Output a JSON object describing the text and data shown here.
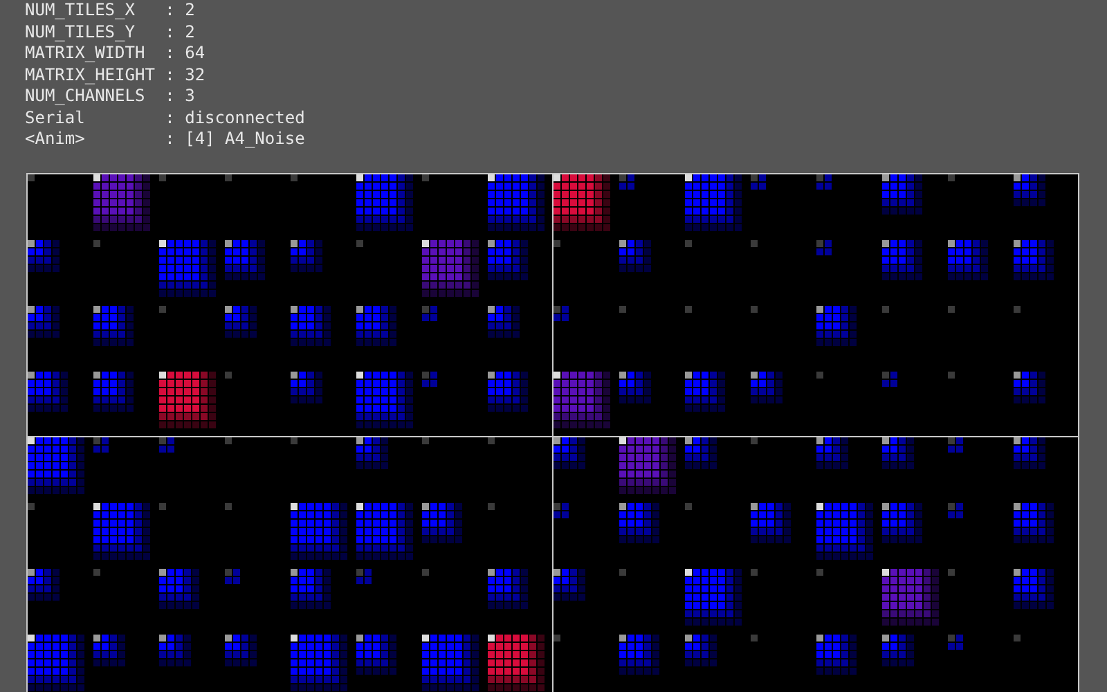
{
  "info_lines": [
    {
      "text": "NUM_TILES_X   : 2"
    },
    {
      "text": "NUM_TILES_Y   : 2"
    },
    {
      "text": "MATRIX_WIDTH  : 64"
    },
    {
      "text": "MATRIX_HEIGHT : 32"
    },
    {
      "text": "NUM_CHANNELS  : 3"
    },
    {
      "text": "Serial        : disconnected"
    },
    {
      "text": "<Anim>        : [4] A4_Noise"
    }
  ]
}
